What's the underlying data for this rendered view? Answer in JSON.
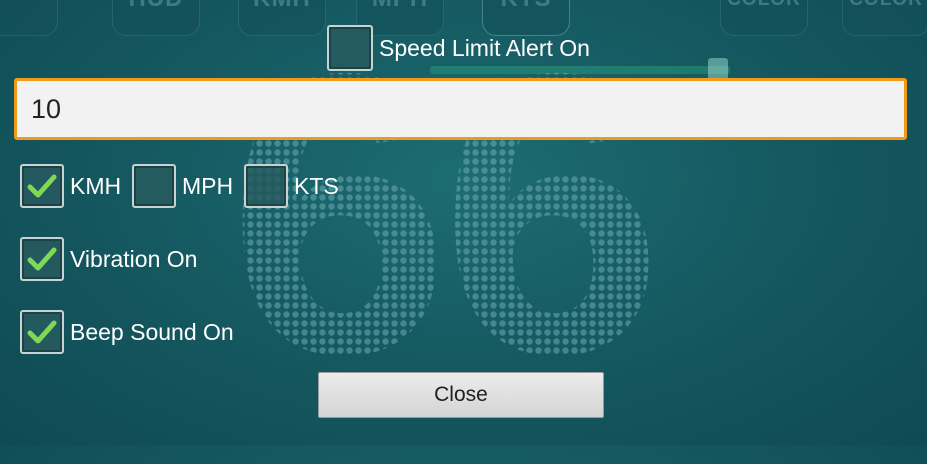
{
  "background": {
    "tiles": [
      "HUD",
      "KMH",
      "MPH",
      "KTS",
      "COLOR",
      "COLOR"
    ],
    "speed_value": "66"
  },
  "alert": {
    "label": "Speed Limit Alert On",
    "checked": false
  },
  "speed_limit": {
    "value": "10"
  },
  "units": [
    {
      "label": "KMH",
      "checked": true
    },
    {
      "label": "MPH",
      "checked": false
    },
    {
      "label": "KTS",
      "checked": false
    }
  ],
  "vibration": {
    "label": "Vibration On",
    "checked": true
  },
  "beep": {
    "label": "Beep Sound On",
    "checked": true
  },
  "close_label": "Close",
  "colors": {
    "accent_border": "#f09a1c",
    "check_green": "#7ed957",
    "background": "#165a62"
  }
}
